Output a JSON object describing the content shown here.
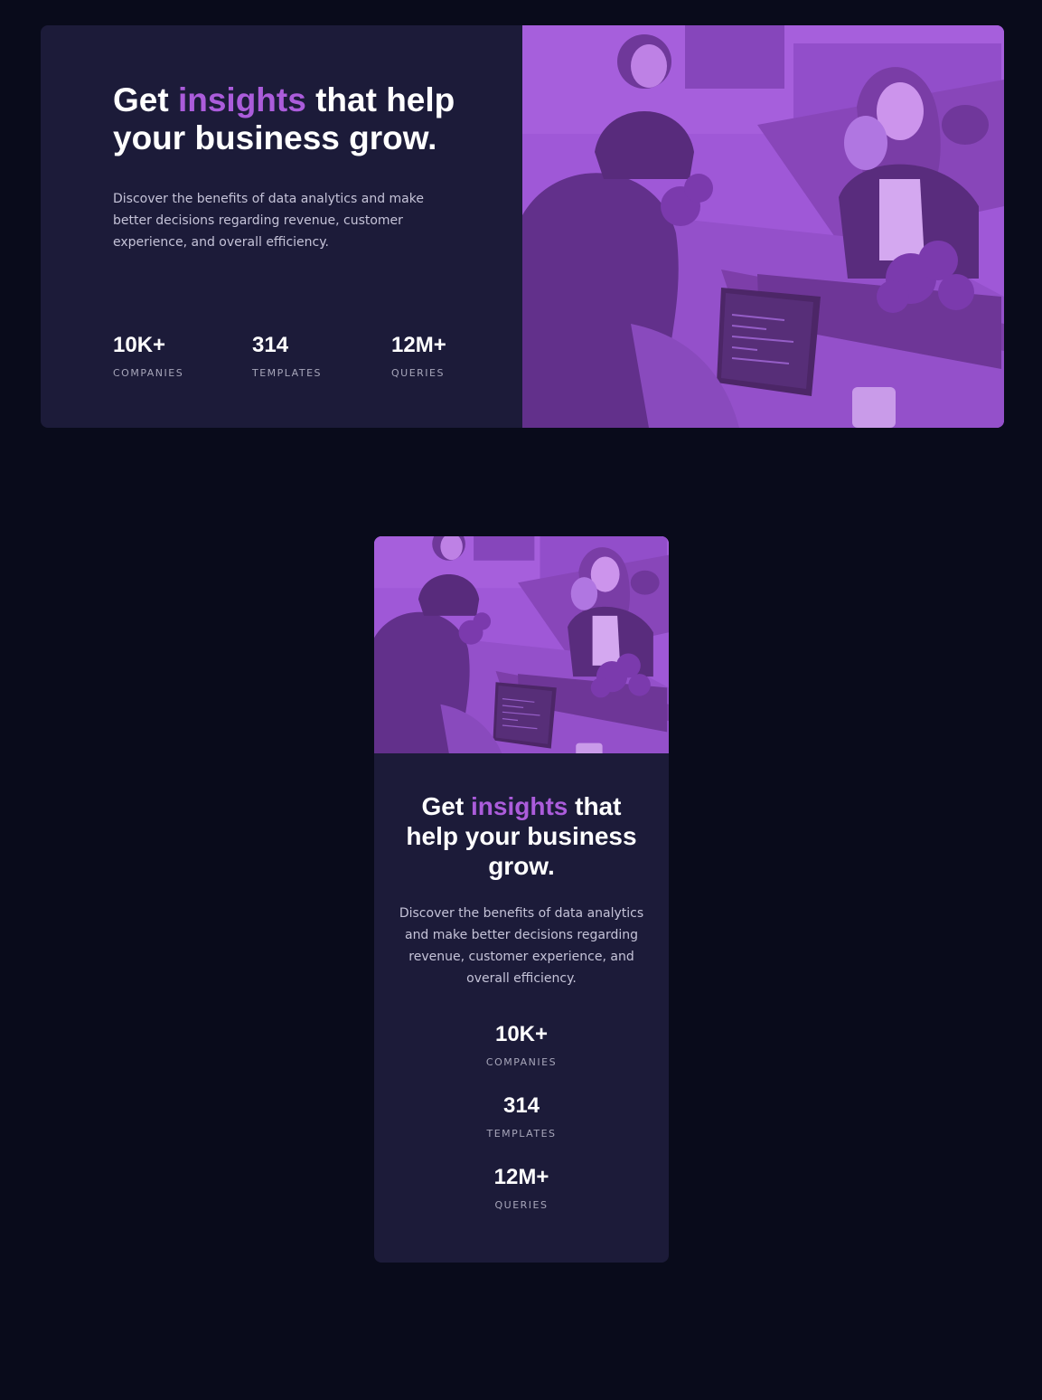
{
  "headline": {
    "prefix": "Get ",
    "accent": "insights",
    "suffix": " that help your business grow."
  },
  "description": "Discover the benefits of data analytics and make better decisions regarding revenue, customer experience, and overall efficiency.",
  "stats": [
    {
      "value": "10K+",
      "label": "COMPANIES"
    },
    {
      "value": "314",
      "label": "TEMPLATES"
    },
    {
      "value": "12M+",
      "label": "QUERIES"
    }
  ],
  "colors": {
    "page_background": "#090b1b",
    "card_background": "#1c1b39",
    "accent": "#ab5cdb",
    "heading": "#ffffff",
    "body_text": "#c5c3d8",
    "stat_label": "#a7a6ba"
  },
  "images": {
    "hero_photo": "image-header-office-coworkers"
  }
}
